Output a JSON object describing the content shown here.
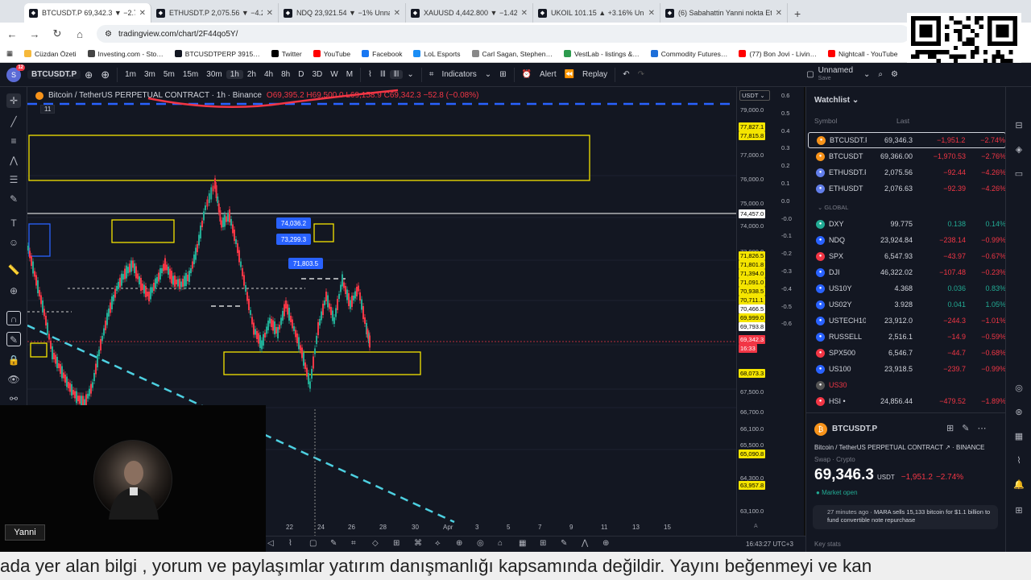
{
  "browser": {
    "tabs": [
      {
        "title": "BTCUSDT.P 69,342.3 ▼ −2.74%",
        "active": true
      },
      {
        "title": "ETHUSDT.P 2,075.56 ▼ −4.26%",
        "active": false
      },
      {
        "title": "NDQ 23,921.54 ▼ −1% Unnam…",
        "active": false
      },
      {
        "title": "XAUUSD 4,442.800 ▼ −1.42% U…",
        "active": false
      },
      {
        "title": "UKOIL 101.15 ▲ +3.16% Unnam…",
        "active": false
      },
      {
        "title": "(6) Sabahattin Yanni nokta Eteh…",
        "active": false
      }
    ],
    "url": "tradingview.com/chart/2F44qo5Y/",
    "bookmarks": [
      "Cüzdan Özeti",
      "Investing.com - Sto…",
      "BTCUSDTPERP 3915…",
      "Twitter",
      "YouTube",
      "Facebook",
      "LoL Esports",
      "Carl Sagan, Stephen…",
      "VestLab - listings &…",
      "Commodity Futures…",
      "(77) Bon Jovi - Livin…",
      "Nightcall - YouTube"
    ],
    "notification_count": "12"
  },
  "toolbar": {
    "avatar_letter": "S",
    "symbol": "BTCUSDT.P",
    "timeframes": [
      "1m",
      "3m",
      "5m",
      "15m",
      "30m",
      "1h",
      "2h",
      "4h",
      "8h",
      "D",
      "3D",
      "W",
      "M"
    ],
    "active_timeframe": "1h",
    "indicators_label": "Indicators",
    "alert_label": "Alert",
    "replay_label": "Replay",
    "layout_name": "Unnamed",
    "layout_sub": "Save"
  },
  "chart": {
    "legend": "Bitcoin / TetherUS PERPETUAL CONTRACT · 1h · Binance",
    "ohlc": "O69,395.2 H69,500.0 L69,158.9 C69,342.3 −52.8 (−0.08%)",
    "indicator_count": "11",
    "currency": "USDT",
    "price_labels": [
      "79,000.0",
      "77,000.0",
      "76,000.0",
      "75,000.0",
      "74,000.0",
      "73,000.0",
      "67,500.0",
      "66,700.0",
      "66,100.0",
      "65,500.0",
      "64,300.0",
      "63,100.0"
    ],
    "price_tags": [
      {
        "v": "77,827.1",
        "c": "yellow"
      },
      {
        "v": "77,815.8",
        "c": "yellow"
      },
      {
        "v": "74,457.0",
        "c": "white"
      },
      {
        "v": "71,826.5",
        "c": "yellow"
      },
      {
        "v": "71,801.8",
        "c": "yellow"
      },
      {
        "v": "71,394.0",
        "c": "yellow"
      },
      {
        "v": "71,091.0",
        "c": "yellow"
      },
      {
        "v": "70,938.5",
        "c": "yellow"
      },
      {
        "v": "70,711.1",
        "c": "yellow"
      },
      {
        "v": "70,466.5",
        "c": "white"
      },
      {
        "v": "69,999.0",
        "c": "yellow"
      },
      {
        "v": "69,793.8",
        "c": "white"
      },
      {
        "v": "69,342.3",
        "c": "red"
      },
      {
        "v": "16:33",
        "c": "red"
      },
      {
        "v": "68,073.3",
        "c": "yellow"
      },
      {
        "v": "65,090.8",
        "c": "yellow"
      },
      {
        "v": "63,957.8",
        "c": "yellow"
      }
    ],
    "scale_labels": [
      "0.6",
      "0.5",
      "0.4",
      "0.3",
      "0.2",
      "0.1",
      "0.0",
      "-0.0",
      "-0.1",
      "-0.2",
      "-0.3",
      "-0.4",
      "-0.5",
      "-0.6"
    ],
    "scale_top": "0.6",
    "callouts": [
      "74,036.2",
      "73,299.3",
      "71,803.5"
    ],
    "x_labels": [
      "22",
      "24",
      "26",
      "28",
      "30",
      "Apr",
      "3",
      "5",
      "7",
      "9",
      "11",
      "13",
      "15"
    ],
    "clock": "16:43:27 UTC+3",
    "axis_mode": "A"
  },
  "watchlist": {
    "title": "Watchlist",
    "col_symbol": "Symbol",
    "col_last": "Last",
    "group": "GLOBAL",
    "crypto": [
      {
        "sym": "BTCUSDT.P",
        "last": "69,346.3",
        "chg": "−1,951.2",
        "pct": "−2.74%",
        "color": "#f7931a"
      },
      {
        "sym": "BTCUSDT",
        "last": "69,366.00",
        "chg": "−1,970.53",
        "pct": "−2.76%",
        "color": "#f7931a"
      },
      {
        "sym": "ETHUSDT.P",
        "last": "2,075.56",
        "chg": "−92.44",
        "pct": "−4.26%",
        "color": "#627eea"
      },
      {
        "sym": "ETHUSDT",
        "last": "2,076.63",
        "chg": "−92.39",
        "pct": "−4.26%",
        "color": "#627eea"
      }
    ],
    "global": [
      {
        "sym": "DXY",
        "last": "99.775",
        "chg": "0.138",
        "pct": "0.14%",
        "up": true,
        "color": "#22ab94"
      },
      {
        "sym": "NDQ",
        "last": "23,924.84",
        "chg": "−238.14",
        "pct": "−0.99%",
        "up": false,
        "color": "#2962ff"
      },
      {
        "sym": "SPX",
        "last": "6,547.93",
        "chg": "−43.97",
        "pct": "−0.67%",
        "up": false,
        "color": "#f23645"
      },
      {
        "sym": "DJI",
        "last": "46,322.02",
        "chg": "−107.48",
        "pct": "−0.23%",
        "up": false,
        "color": "#2962ff"
      },
      {
        "sym": "US10Y",
        "last": "4.368",
        "chg": "0.036",
        "pct": "0.83%",
        "up": true,
        "color": "#2962ff"
      },
      {
        "sym": "US02Y",
        "last": "3.928",
        "chg": "0.041",
        "pct": "1.05%",
        "up": true,
        "color": "#2962ff"
      },
      {
        "sym": "USTECH100",
        "last": "23,912.0",
        "chg": "−244.3",
        "pct": "−1.01%",
        "up": false,
        "color": "#2962ff"
      },
      {
        "sym": "RUSSELL",
        "last": "2,516.1",
        "chg": "−14.9",
        "pct": "−0.59%",
        "up": false,
        "color": "#2962ff"
      },
      {
        "sym": "SPX500",
        "last": "6,546.7",
        "chg": "−44.7",
        "pct": "−0.68%",
        "up": false,
        "color": "#f23645"
      },
      {
        "sym": "US100",
        "last": "23,918.5",
        "chg": "−239.7",
        "pct": "−0.99%",
        "up": false,
        "color": "#2962ff"
      },
      {
        "sym": "US30",
        "last": "",
        "chg": "",
        "pct": "",
        "up": false,
        "color": "#555555"
      },
      {
        "sym": "HSI •",
        "last": "24,856.44",
        "chg": "−479.52",
        "pct": "−1.89%",
        "up": false,
        "color": "#f23645"
      }
    ]
  },
  "details": {
    "symbol": "BTCUSDT.P",
    "desc": "Bitcoin / TetherUS PERPETUAL CONTRACT",
    "exchange": "BINANCE",
    "type": "Swap · Crypto",
    "price": "69,346.3",
    "currency": "USDT",
    "change": "−1,951.2",
    "change_pct": "−2.74%",
    "market_status": "Market open",
    "news_time": "27 minutes ago",
    "news_text": "MARA sells 15,133 bitcoin for $1.1 billion to fund convertible note repurchase",
    "key_stats": "Key stats"
  },
  "webcam": {
    "name": "Yanni"
  },
  "ticker": "ada yer alan bilgi , yorum ve paylaşımlar yatırım danışmanlığı kapsamında değildir. Yayını beğenmeyi ve kan"
}
